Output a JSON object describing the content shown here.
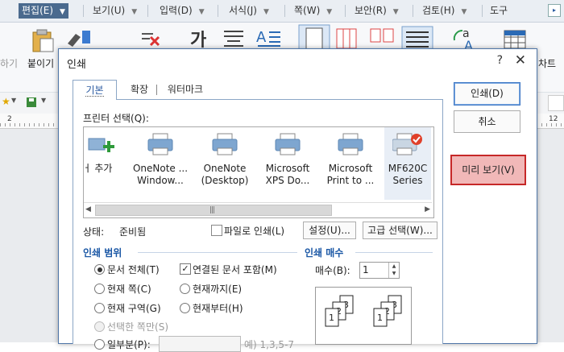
{
  "menubar": {
    "items": [
      {
        "label": "편집(E)",
        "active": true
      },
      {
        "label": "보기(U)"
      },
      {
        "label": "입력(D)"
      },
      {
        "label": "서식(J)"
      },
      {
        "label": "쪽(W)"
      },
      {
        "label": "보안(R)"
      },
      {
        "label": "검토(H)"
      },
      {
        "label": "도구"
      }
    ],
    "scroll_glyph": "▸"
  },
  "toolbar": {
    "left_labels": [
      "하기",
      "붙이기"
    ],
    "right_label": "차트"
  },
  "ruler": {
    "left_num": "2",
    "right_num": "12"
  },
  "dialog": {
    "title": "인쇄",
    "help": "?",
    "close": "✕",
    "tabs": [
      {
        "label": "기본"
      },
      {
        "label": "확장"
      },
      {
        "label": "워터마크"
      }
    ],
    "printer_label": "프린터 선택(Q):",
    "printers": [
      {
        "line1": "ㅓ 추가",
        "line2": "",
        "icon": "add-printer-icon"
      },
      {
        "line1": "OneNote ...",
        "line2": "Window...",
        "icon": "printer-icon"
      },
      {
        "line1": "OneNote",
        "line2": "(Desktop)",
        "icon": "printer-icon"
      },
      {
        "line1": "Microsoft",
        "line2": "XPS Do...",
        "icon": "printer-icon"
      },
      {
        "line1": "Microsoft",
        "line2": "Print to ...",
        "icon": "printer-icon"
      },
      {
        "line1": "MF620C",
        "line2": "Series",
        "icon": "default-printer-icon",
        "selected": true
      }
    ],
    "scroll_left": "◀",
    "scroll_right": "▶",
    "scroll_grip": "|||",
    "status_label": "상태:",
    "status_value": "준비됨",
    "print_to_file_label": "파일로 인쇄(L)",
    "settings_label": "설정(U)...",
    "advanced_label": "고급 선택(W)...",
    "range": {
      "title": "인쇄 범위",
      "all_doc": "문서 전체(T)",
      "linked_docs": "연결된 문서 포함(M)",
      "current_page": "현재 쪽(C)",
      "until_current": "현재까지(E)",
      "current_section": "현재 구역(G)",
      "from_current": "현재부터(H)",
      "selected_pages": "선택한 쪽만(S)",
      "partial": "일부분(P):",
      "partial_hint": "예) 1,3,5-7",
      "linked_checked": true
    },
    "copies": {
      "title": "인쇄 매수",
      "label": "매수(B):",
      "value": "1"
    },
    "buttons": {
      "print": "인쇄(D)",
      "cancel": "취소",
      "preview": "미리 보기(V)"
    }
  },
  "colors": {
    "accent": "#1a57a5",
    "highlight_border": "#c62828",
    "highlight_fill": "#f1b8b8"
  }
}
